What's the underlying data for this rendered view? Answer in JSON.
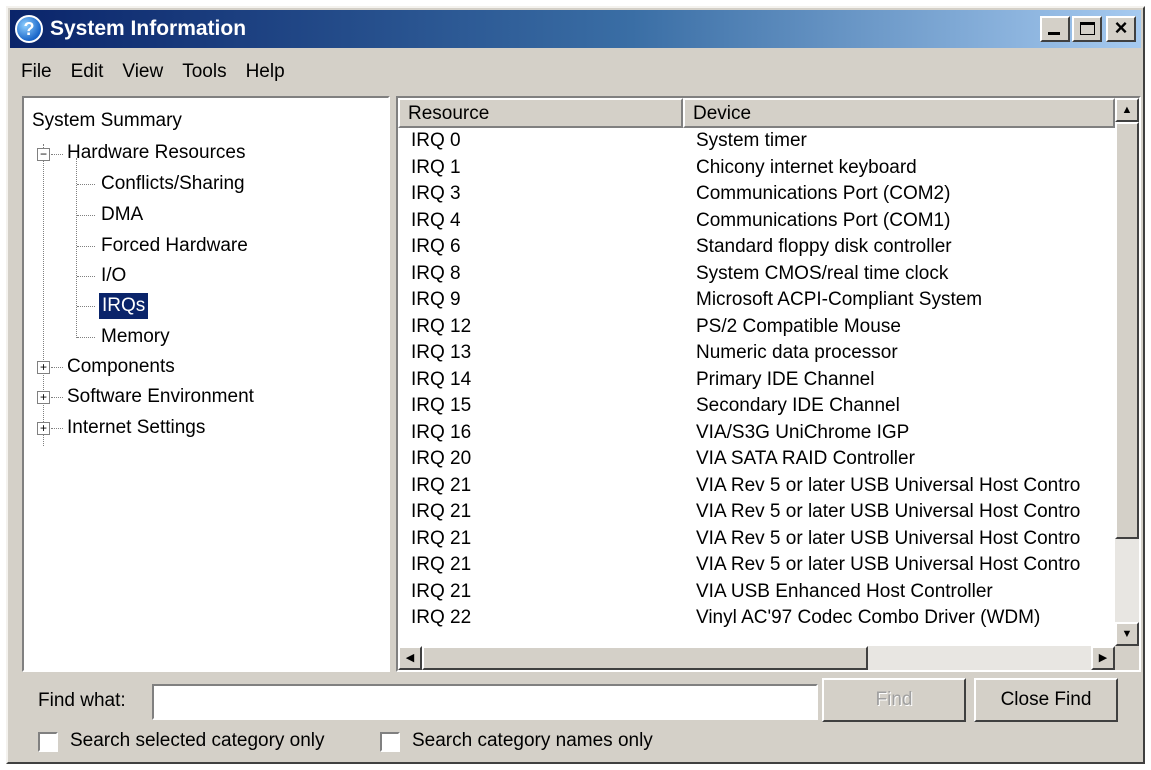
{
  "window": {
    "title": "System Information",
    "icon": "question-mark-icon"
  },
  "menu": [
    "File",
    "Edit",
    "View",
    "Tools",
    "Help"
  ],
  "tree": {
    "root": "System Summary",
    "hardware": "Hardware Resources",
    "hardware_children": [
      "Conflicts/Sharing",
      "DMA",
      "Forced Hardware",
      "I/O",
      "IRQs",
      "Memory"
    ],
    "selected": "IRQs",
    "collapsed": [
      "Components",
      "Software Environment",
      "Internet Settings"
    ]
  },
  "columns": {
    "resource": "Resource",
    "device": "Device"
  },
  "rows": [
    {
      "resource": "IRQ 0",
      "device": "System timer"
    },
    {
      "resource": "IRQ 1",
      "device": "Chicony internet keyboard"
    },
    {
      "resource": "IRQ 3",
      "device": "Communications Port (COM2)"
    },
    {
      "resource": "IRQ 4",
      "device": "Communications Port (COM1)"
    },
    {
      "resource": "IRQ 6",
      "device": "Standard floppy disk controller"
    },
    {
      "resource": "IRQ 8",
      "device": "System CMOS/real time clock"
    },
    {
      "resource": "IRQ 9",
      "device": "Microsoft ACPI-Compliant System"
    },
    {
      "resource": "IRQ 12",
      "device": "PS/2 Compatible Mouse"
    },
    {
      "resource": "IRQ 13",
      "device": "Numeric data processor"
    },
    {
      "resource": "IRQ 14",
      "device": "Primary IDE Channel"
    },
    {
      "resource": "IRQ 15",
      "device": "Secondary IDE Channel"
    },
    {
      "resource": "IRQ 16",
      "device": "VIA/S3G UniChrome IGP"
    },
    {
      "resource": "IRQ 20",
      "device": "VIA SATA RAID Controller"
    },
    {
      "resource": "IRQ 21",
      "device": "VIA Rev 5 or later USB Universal Host Contro"
    },
    {
      "resource": "IRQ 21",
      "device": "VIA Rev 5 or later USB Universal Host Contro"
    },
    {
      "resource": "IRQ 21",
      "device": "VIA Rev 5 or later USB Universal Host Contro"
    },
    {
      "resource": "IRQ 21",
      "device": "VIA Rev 5 or later USB Universal Host Contro"
    },
    {
      "resource": "IRQ 21",
      "device": "VIA USB Enhanced Host Controller"
    },
    {
      "resource": "IRQ 22",
      "device": "Vinyl AC'97 Codec Combo Driver (WDM)"
    }
  ],
  "find": {
    "label": "Find what:",
    "value": "",
    "find_button": "Find",
    "close_button": "Close Find",
    "checkbox_selected_category": "Search selected category only",
    "checkbox_category_names": "Search category names only"
  }
}
